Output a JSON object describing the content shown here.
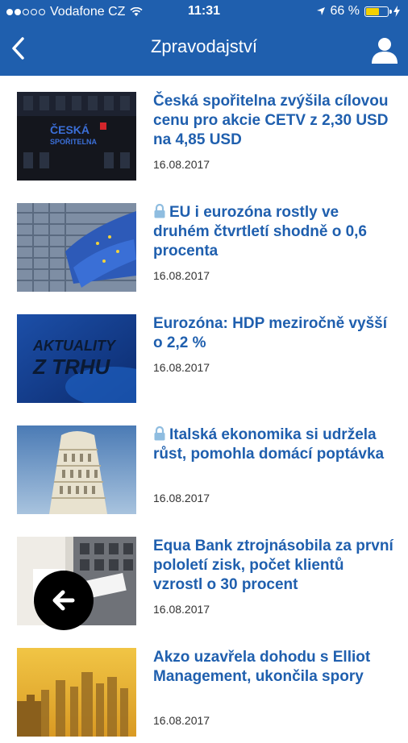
{
  "status": {
    "carrier": "Vodafone CZ",
    "time": "11:31",
    "battery": "66 %",
    "battery_level": 0.66
  },
  "nav": {
    "title": "Zpravodajství"
  },
  "articles": [
    {
      "title": "Česká spořitelna zvýšila cílovou cenu pro akcie CETV z 2,30 USD na 4,85 USD",
      "date": "16.08.2017",
      "locked": false,
      "thumb_text_1": "ČESKÁ",
      "thumb_text_2": "SPOŘITELNA"
    },
    {
      "title": "EU i eurozóna rostly ve druhém čtvrtletí shodně o 0,6 procenta",
      "date": "16.08.2017",
      "locked": true
    },
    {
      "title": "Eurozóna: HDP meziročně vyšší o 2,2 %",
      "date": "16.08.2017",
      "locked": false,
      "thumb_text_1": "AKTUALITY",
      "thumb_text_2": "Z TRHU"
    },
    {
      "title": "Italská ekonomika si udržela růst, pomohla domácí poptávka",
      "date": "16.08.2017",
      "locked": true
    },
    {
      "title": "Equa Bank ztrojnásobila za první pololetí zisk, počet klientů vzrostl o 30 procent",
      "date": "16.08.2017",
      "locked": false
    },
    {
      "title": "Akzo uzavřela dohodu s Elliot Management, ukončila spory",
      "date": "16.08.2017",
      "locked": false
    }
  ],
  "icons": {
    "back": "chevron-left-icon",
    "user": "user-icon",
    "lock": "lock-icon",
    "fab": "arrow-left-icon"
  },
  "colors": {
    "brand": "#1f5fae",
    "headline": "#1f5fae",
    "battery": "#f5d100"
  }
}
